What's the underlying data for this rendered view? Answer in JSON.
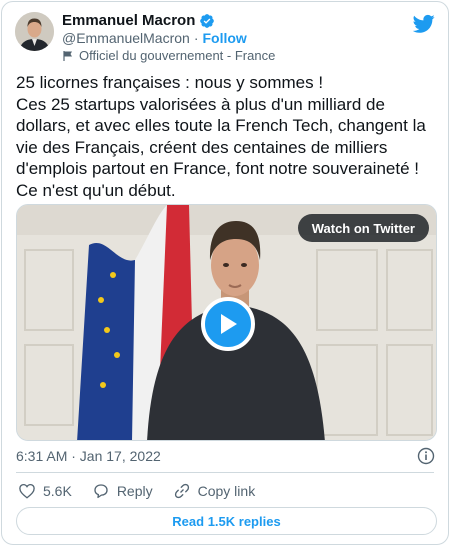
{
  "author": {
    "name": "Emmanuel Macron",
    "handle": "@EmmanuelMacron",
    "separator": "·",
    "follow_label": "Follow",
    "label_text": "Officiel du gouvernement - France"
  },
  "tweet": {
    "text": "25 licornes françaises : nous y sommes !\nCes 25 startups valorisées à plus d'un milliard de dollars, et avec elles toute la French Tech, changent la vie des Français, créent des centaines de milliers d'emplois partout en France, font notre souveraineté ! Ce n'est qu'un début."
  },
  "media": {
    "watch_label": "Watch on Twitter",
    "play_icon": "play-icon"
  },
  "meta": {
    "timestamp": "6:31 AM · Jan 17, 2022"
  },
  "actions": {
    "like_count": "5.6K",
    "reply_label": "Reply",
    "copy_label": "Copy link"
  },
  "replies_button": "Read 1.5K replies",
  "colors": {
    "accent": "#1d9bf0",
    "text": "#0f1419",
    "muted": "#536471",
    "border": "#cfd9de"
  }
}
